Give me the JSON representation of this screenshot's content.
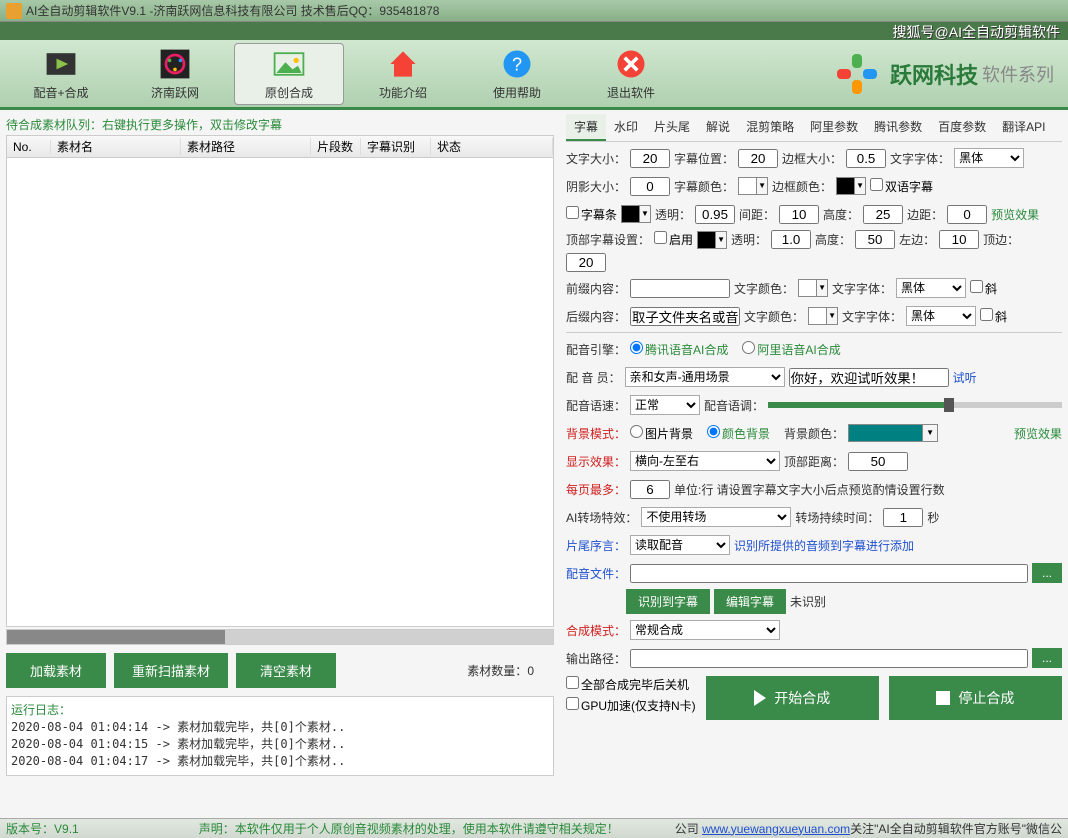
{
  "titlebar": "AI全自动剪辑软件V9.1 -济南跃网信息科技有限公司 技术售后QQ：935481878",
  "topbanner": "搜狐号@AI全自动剪辑软件",
  "toolbar": {
    "items": [
      {
        "label": "配音+合成"
      },
      {
        "label": "济南跃网"
      },
      {
        "label": "原创合成"
      },
      {
        "label": "功能介绍"
      },
      {
        "label": "使用帮助"
      },
      {
        "label": "退出软件"
      }
    ]
  },
  "logo": {
    "text": "跃网科技",
    "sub": "软件系列"
  },
  "left": {
    "hint": "待合成素材队列：右键执行更多操作，双击修改字幕",
    "headers": {
      "no": "No.",
      "name": "素材名",
      "path": "素材路径",
      "seg": "片段数",
      "rec": "字幕识别",
      "stat": "状态"
    },
    "btns": {
      "load": "加载素材",
      "rescan": "重新扫描素材",
      "clear": "清空素材"
    },
    "count_lbl": "素材数量：",
    "count_val": "0"
  },
  "log": {
    "title": "运行日志：",
    "lines": [
      "2020-08-04 01:04:14 -> 素材加载完毕，共[0]个素材..",
      "2020-08-04 01:04:15 -> 素材加载完毕，共[0]个素材..",
      "2020-08-04 01:04:17 -> 素材加载完毕，共[0]个素材.."
    ]
  },
  "tabs": [
    "字幕",
    "水印",
    "片头尾",
    "解说",
    "混剪策略",
    "阿里参数",
    "腾讯参数",
    "百度参数",
    "翻译API"
  ],
  "form": {
    "fontsize_lbl": "文字大小：",
    "fontsize": "20",
    "subpos_lbl": "字幕位置：",
    "subpos": "20",
    "border_lbl": "边框大小：",
    "border": "0.5",
    "font_lbl": "文字字体：",
    "font": "黑体",
    "shadow_lbl": "阴影大小：",
    "shadow": "0",
    "subcolor_lbl": "字幕颜色：",
    "bordercolor_lbl": "边框颜色：",
    "bilingual": "双语字幕",
    "subbar": "字幕条",
    "opacity_lbl": "透明：",
    "opacity": "0.95",
    "gap_lbl": "间距：",
    "gap": "10",
    "height_lbl": "高度：",
    "height": "25",
    "margin_lbl": "边距：",
    "margin": "0",
    "preview": "预览效果",
    "topset_lbl": "顶部字幕设置：",
    "enable": "启用",
    "opacity2_lbl": "透明：",
    "opacity2": "1.0",
    "height2_lbl": "高度：",
    "height2": "50",
    "left_lbl": "左边：",
    "left": "10",
    "top_lbl": "顶边：",
    "top": "20",
    "prefix_lbl": "前缀内容：",
    "prefix": "",
    "txtcolor_lbl": "文字颜色：",
    "txtfont_lbl": "文字字体：",
    "txtfont": "黑体",
    "italic": "斜",
    "suffix_lbl": "后缀内容：",
    "suffix": "取子文件夹名或音频",
    "suffix_font": "黑体",
    "engine_lbl": "配音引擎：",
    "engine_tencent": "腾讯语音AI合成",
    "engine_ali": "阿里语音AI合成",
    "voice_lbl": "配 音 员：",
    "voice_sel": "亲和女声-通用场景",
    "voice_test": "你好，欢迎试听效果！",
    "listen": "试听",
    "speed_lbl": "配音语速：",
    "speed": "正常",
    "tone_lbl": "配音语调：",
    "bgmode_lbl": "背景模式：",
    "bg_img": "图片背景",
    "bg_color": "颜色背景",
    "bgcolor_lbl": "背景颜色：",
    "disp_lbl": "显示效果：",
    "disp": "横向-左至右",
    "topdist_lbl": "顶部距离：",
    "topdist": "50",
    "maxrows_lbl": "每页最多：",
    "maxrows": "6",
    "maxrows_unit": "单位:行 请设置字幕文字大小后点预览酌情设置行数",
    "trans_lbl": "AI转场特效：",
    "trans": "不使用转场",
    "transdur_lbl": "转场持续时间：",
    "transdur": "1",
    "transdur_unit": "秒",
    "tailv_lbl": "片尾序言：",
    "tailv": "读取配音",
    "tailv_hint": "识别所提供的音频到字幕进行添加",
    "voicefile_lbl": "配音文件：",
    "btn_recog": "识别到字幕",
    "btn_edit": "编辑字幕",
    "unrec": "未识别",
    "mode_lbl": "合成模式：",
    "mode": "常规合成",
    "outpath_lbl": "输出路径：",
    "chk_shutdown": "全部合成完毕后关机",
    "chk_gpu": "GPU加速(仅支持N卡)",
    "btn_start": "开始合成",
    "btn_stop": "停止合成"
  },
  "status": {
    "ver_lbl": "版本号：",
    "ver": "V9.1",
    "decl_lbl": "声明：",
    "decl": "本软件仅用于个人原创音视频素材的处理，使用本软件请遵守相关规定！",
    "comp": "公司",
    "url": "www.yuewangxueyuan.com",
    "tail": " 关注\"AI全自动剪辑软件官方账号\"微信公"
  }
}
